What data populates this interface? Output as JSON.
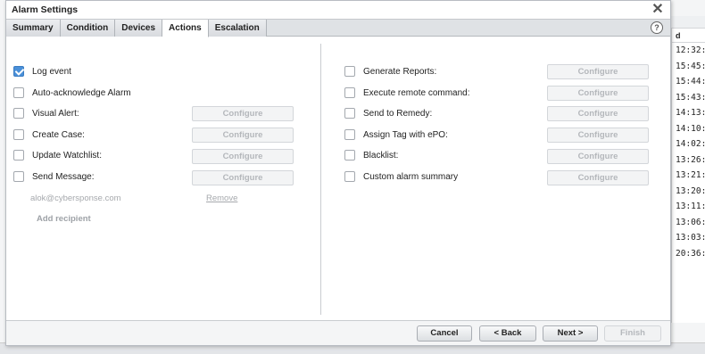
{
  "dialog": {
    "title": "Alarm Settings",
    "close_glyph": "✕",
    "help_glyph": "?"
  },
  "tabs": [
    {
      "label": "Summary"
    },
    {
      "label": "Condition"
    },
    {
      "label": "Devices"
    },
    {
      "label": "Actions",
      "active": true
    },
    {
      "label": "Escalation"
    }
  ],
  "left_actions": {
    "log_event": {
      "label": "Log event",
      "checked": true
    },
    "auto_ack": {
      "label": "Auto-acknowledge Alarm",
      "checked": false
    },
    "visual_alert": {
      "label": "Visual Alert:",
      "checked": false,
      "button": "Configure"
    },
    "create_case": {
      "label": "Create Case:",
      "checked": false,
      "button": "Configure"
    },
    "update_watchlist": {
      "label": "Update Watchlist:",
      "checked": false,
      "button": "Configure"
    },
    "send_message": {
      "label": "Send Message:",
      "checked": false,
      "button": "Configure"
    },
    "recipient_email": "alok@cybersponse.com",
    "remove_link": "Remove",
    "add_recipient": "Add recipient"
  },
  "right_actions": {
    "generate_reports": {
      "label": "Generate Reports:",
      "checked": false,
      "button": "Configure"
    },
    "execute_remote": {
      "label": "Execute remote command:",
      "checked": false,
      "button": "Configure"
    },
    "send_remedy": {
      "label": "Send to Remedy:",
      "checked": false,
      "button": "Configure"
    },
    "assign_tag": {
      "label": "Assign Tag with ePO:",
      "checked": false,
      "button": "Configure"
    },
    "blacklist": {
      "label": "Blacklist:",
      "checked": false,
      "button": "Configure"
    },
    "custom_summary": {
      "label": "Custom alarm summary",
      "checked": false,
      "button": "Configure"
    }
  },
  "footer": {
    "cancel": "Cancel",
    "back": "< Back",
    "next": "Next >",
    "finish": "Finish"
  },
  "background": {
    "column_header": "d",
    "times": [
      "12:32:",
      "15:45:",
      "15:44:",
      "15:43:",
      "14:13:",
      "14:10:",
      "14:02:",
      "13:26:",
      "13:21:",
      "13:20:",
      "13:11:",
      "13:06:",
      "13:03:",
      "20:36:"
    ]
  },
  "colors": {
    "checkbox_checked": "#4a90d9",
    "tab_active_bg": "#ffffff",
    "disabled_text": "#b4b7bb"
  }
}
